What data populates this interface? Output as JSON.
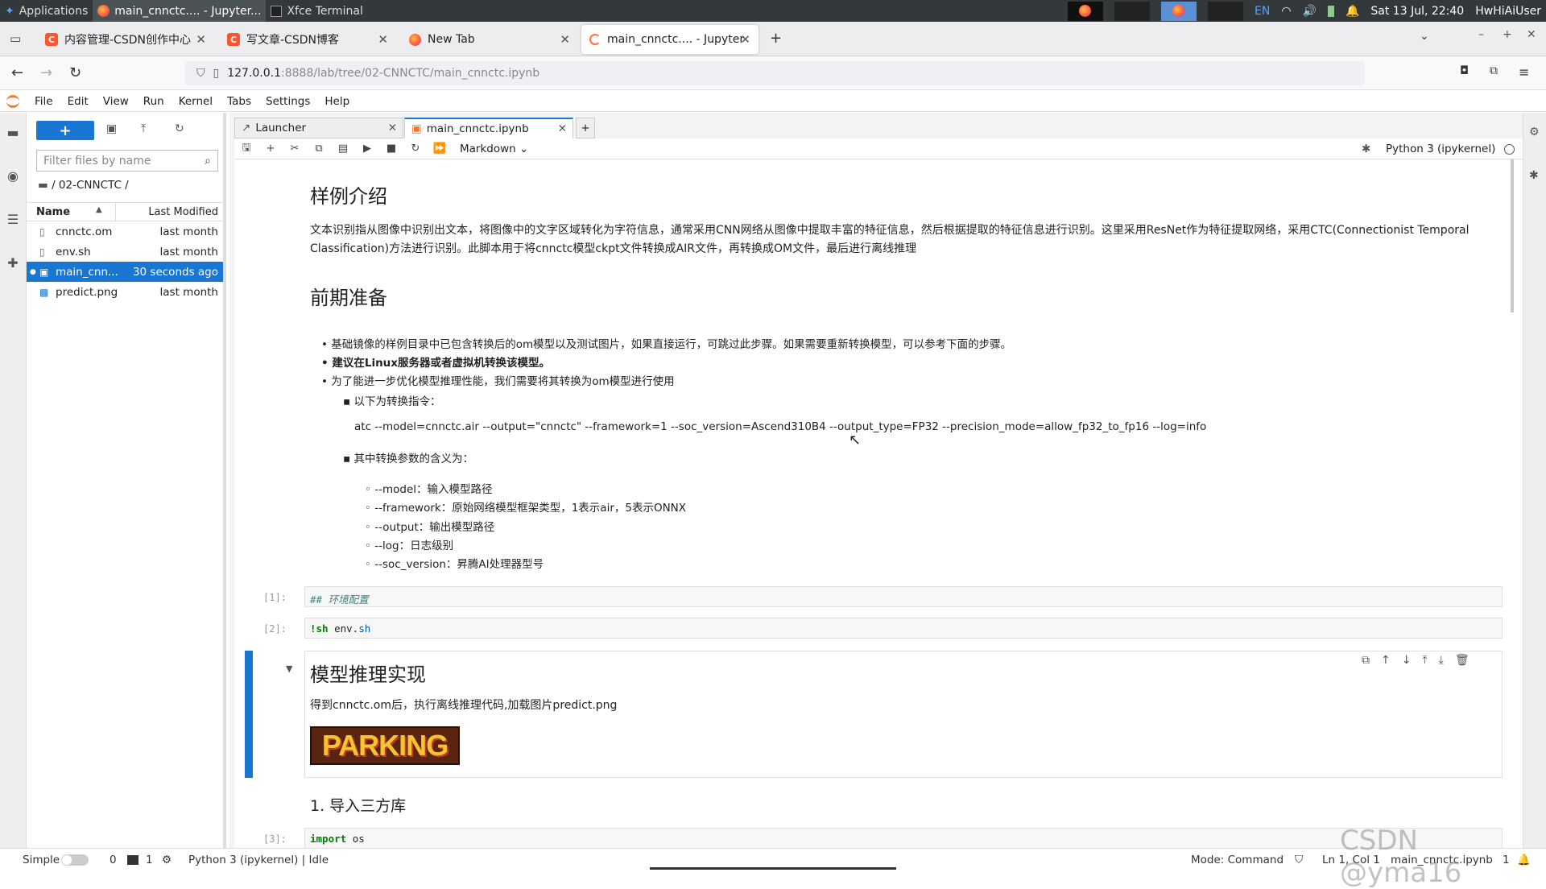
{
  "panel": {
    "apps": "Applications",
    "task1": "main_cnnctc.... - Jupyter...",
    "task2": "Xfce Terminal",
    "lang": "EN",
    "clock": "Sat 13 Jul, 22:40",
    "user": "HwHiAiUser"
  },
  "browser_tabs": [
    {
      "label": "内容管理-CSDN创作中心"
    },
    {
      "label": "写文章-CSDN博客"
    },
    {
      "label": "New Tab"
    },
    {
      "label": "main_cnnctc.... - Jupyter"
    }
  ],
  "url": {
    "host": "127.0.0.1",
    "rest": ":8888/lab/tree/02-CNNCTC/main_cnnctc.ipynb"
  },
  "menu": [
    "File",
    "Edit",
    "View",
    "Run",
    "Kernel",
    "Tabs",
    "Settings",
    "Help"
  ],
  "filebrowser": {
    "filter_placeholder": "Filter files by name",
    "crumb": "/ 02-CNNCTC /",
    "col_name": "Name",
    "col_modified": "Last Modified",
    "files": [
      {
        "name": "cnnctc.om",
        "mod": "last month"
      },
      {
        "name": "env.sh",
        "mod": "last month"
      },
      {
        "name": "main_cnn...",
        "mod": "30 seconds ago"
      },
      {
        "name": "predict.png",
        "mod": "last month"
      }
    ]
  },
  "doc_tabs": [
    {
      "label": "Launcher"
    },
    {
      "label": "main_cnnctc.ipynb"
    }
  ],
  "toolbar": {
    "cell_type": "Markdown",
    "kernel": "Python 3 (ipykernel)"
  },
  "nb": {
    "h_intro": "样例介绍",
    "p_intro1": "文本识别指从图像中识别出文本，将图像中的文字区域转化为字符信息，通常采用CNN网络从图像中提取丰富的特征信息，然后根据提取的特征信息进行识别。这里采用ResNet作为特征提取网络，采用CTC(Connectionist Temporal",
    "p_intro2": "Classification)方法进行识别。此脚本用于将cnnctc模型ckpt文件转换成AIR文件，再转换成OM文件，最后进行离线推理",
    "h_prep": "前期准备",
    "b1": "基础镜像的样例目录中已包含转换后的om模型以及测试图片，如果直接运行，可跳过此步骤。如果需要重新转换模型，可以参考下面的步骤。",
    "b2": "建议在Linux服务器或者虚拟机转换该模型。",
    "b3": "为了能进一步优化模型推理性能，我们需要将其转换为om模型进行使用",
    "sb1": "以下为转换指令：",
    "cmd": "atc --model=cnnctc.air --output=\"cnnctc\" --framework=1 --soc_version=Ascend310B4 --output_type=FP32 --precision_mode=allow_fp32_to_fp16 --log=info",
    "sb2": "其中转换参数的含义为：",
    "params": [
      "--model：输入模型路径",
      "--framework：原始网络模型框架类型，1表示air，5表示ONNX",
      "--output：输出模型路径",
      "--log：日志级别",
      "--soc_version：昇腾AI处理器型号"
    ],
    "p1": "[1]:",
    "c1": "## 环境配置",
    "p2": "[2]:",
    "c2a": "!sh",
    "c2b": "env.",
    "c2c": "sh",
    "h_impl": "模型推理实现",
    "p_impl": "得到cnnctc.om后，执行离线推理代码,加载图片predict.png",
    "parking": "PARKING",
    "h_import": "1. 导入三方库",
    "p3": "[3]:",
    "c3a": "import",
    "c3b": "os"
  },
  "status": {
    "mode": "Simple",
    "n1": "0",
    "n2": "1",
    "kernel": "Python 3 (ipykernel) | Idle",
    "cmd": "Mode: Command",
    "pos": "Ln 1, Col 1",
    "file": "main_cnnctc.ipynb",
    "count": "1"
  },
  "watermark": "CSDN @yma16"
}
